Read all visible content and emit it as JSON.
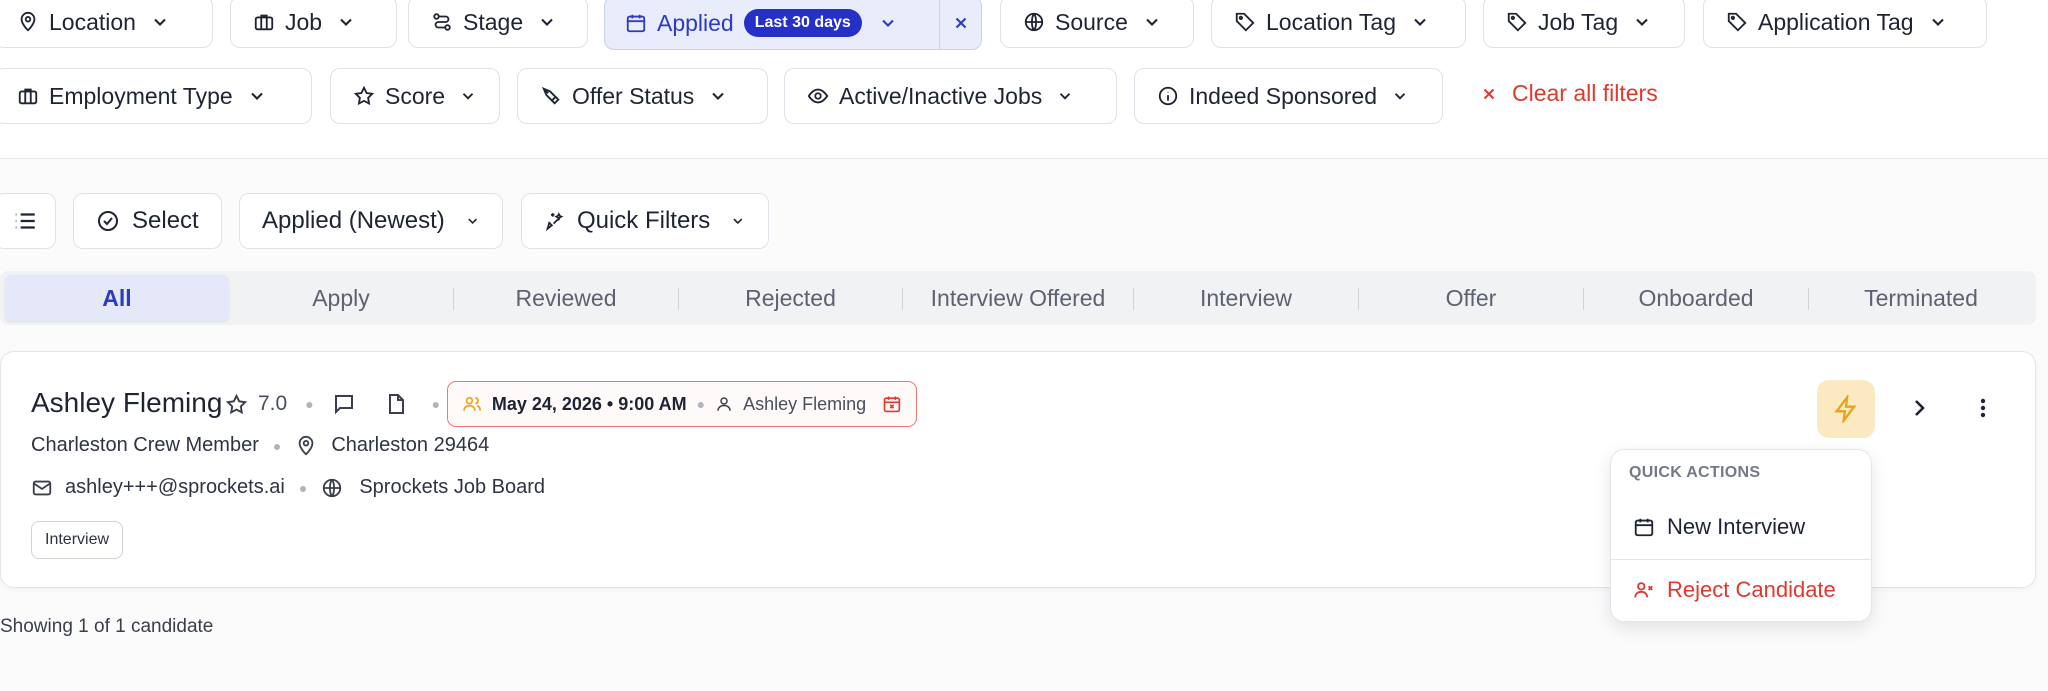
{
  "filters": {
    "row1": [
      {
        "label": "Location",
        "icon": "map-pin-icon"
      },
      {
        "label": "Job",
        "icon": "briefcase-icon"
      },
      {
        "label": "Stage",
        "icon": "route-icon"
      },
      {
        "label": "Source",
        "icon": "globe-icon"
      },
      {
        "label": "Location Tag",
        "icon": "tag-icon"
      },
      {
        "label": "Job Tag",
        "icon": "tag-icon"
      },
      {
        "label": "Application Tag",
        "icon": "tag-icon"
      }
    ],
    "applied": {
      "label": "Applied",
      "badge": "Last 30 days",
      "icon": "calendar-icon"
    },
    "row2": [
      {
        "label": "Employment Type",
        "icon": "briefcase-icon"
      },
      {
        "label": "Score",
        "icon": "star-icon"
      },
      {
        "label": "Offer Status",
        "icon": "pen-nib-icon"
      },
      {
        "label": "Active/Inactive Jobs",
        "icon": "eye-icon"
      },
      {
        "label": "Indeed Sponsored",
        "icon": "info-icon"
      }
    ],
    "clear_all": "Clear all filters"
  },
  "toolbar": {
    "select_label": "Select",
    "sort_label": "Applied (Newest)",
    "quick_filters_label": "Quick Filters"
  },
  "tabs": [
    "All",
    "Apply",
    "Reviewed",
    "Rejected",
    "Interview Offered",
    "Interview",
    "Offer",
    "Onboarded",
    "Terminated"
  ],
  "active_tab": "All",
  "candidate": {
    "name": "Ashley Fleming",
    "score": "7.0",
    "interview_datetime": "May 24, 2026 • 9:00 AM",
    "interviewer": "Ashley Fleming",
    "job": "Charleston Crew Member",
    "location": "Charleston 29464",
    "email": "ashley+++@sprockets.ai",
    "source": "Sprockets Job Board",
    "stage_tag": "Interview"
  },
  "quick_actions": {
    "header": "QUICK ACTIONS",
    "new_interview": "New Interview",
    "reject": "Reject Candidate"
  },
  "footer": {
    "showing": "Showing 1 of 1 candidate"
  },
  "colors": {
    "accent": "#2530c6",
    "danger": "#e0382e",
    "bolt_bg": "#fbe9c2",
    "bolt": "#e8a316"
  }
}
